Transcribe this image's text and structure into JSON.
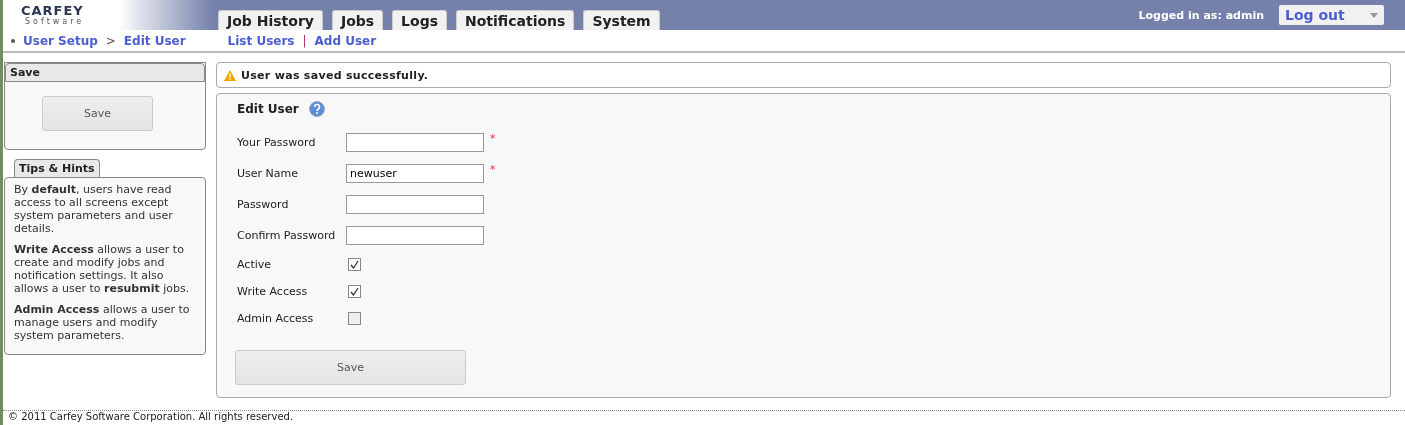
{
  "logo": {
    "name": "CARFEY",
    "tagline": "Software"
  },
  "tabs": [
    {
      "label": "Job History",
      "selected": false
    },
    {
      "label": "Jobs",
      "selected": false
    },
    {
      "label": "Logs",
      "selected": false
    },
    {
      "label": "Notifications",
      "selected": false
    },
    {
      "label": "System",
      "selected": false
    }
  ],
  "user": {
    "logged_in": "Logged in as: admin",
    "menu": "Log out"
  },
  "breadcrumb": [
    {
      "label": "User Setup"
    },
    {
      "label": "Edit User"
    }
  ],
  "breadcrumb_separator": ">",
  "subnav": [
    {
      "label": "List Users"
    },
    {
      "label": "Add User"
    }
  ],
  "subnav_separator": "|",
  "save_panel": {
    "title": "Save",
    "button": "Save"
  },
  "tips_panel": {
    "title": "Tips & Hints",
    "paragraphs": [
      "By **default**, users have read access to all screens except system parameters and user details.",
      "**Write Access** allows a user to create and modify jobs and notification settings. It also allows a user to **resubmit** jobs.",
      "**Admin Access** allows a user to manage users and modify system parameters."
    ]
  },
  "message": "User was saved successfully.",
  "form": {
    "title": "Edit User",
    "fields": [
      {
        "kind": "text",
        "label": "Your Password",
        "required": true
      },
      {
        "kind": "text",
        "label": "User Name",
        "value": "newuser",
        "required": true
      },
      {
        "kind": "text",
        "label": "Password",
        "required": false
      },
      {
        "kind": "text",
        "label": "Confirm Password",
        "required": false
      },
      {
        "kind": "checkbox",
        "label": "Active",
        "checked": true
      },
      {
        "kind": "checkbox",
        "label": "Write Access",
        "checked": true
      },
      {
        "kind": "checkbox",
        "label": "Admin Access",
        "checked": false
      }
    ],
    "required_mark": "*",
    "button": "Save"
  },
  "footer": "© 2011 Carfey Software Corporation. All rights reserved."
}
